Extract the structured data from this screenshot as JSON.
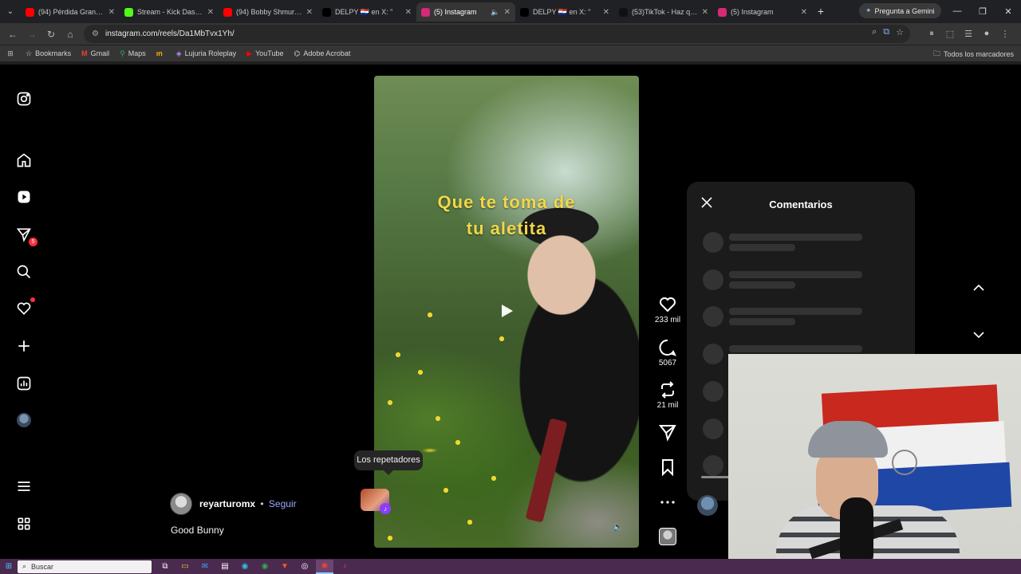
{
  "browser": {
    "tabs": [
      {
        "label": "(94) Pérdida Grande...",
        "icon": "youtube-icon",
        "color": "#ff0000",
        "active": false
      },
      {
        "label": "Stream - Kick Dashbo",
        "icon": "kick-icon",
        "color": "#53fc18",
        "active": false
      },
      {
        "label": "(94) Bobby Shmurda",
        "icon": "youtube-icon",
        "color": "#ff0000",
        "active": false
      },
      {
        "label": "DELPY 🇵🇾 en X: \"",
        "icon": "x-icon",
        "color": "#000000",
        "active": false
      },
      {
        "label": "(5) Instagram",
        "icon": "instagram-icon",
        "color": "#d62976",
        "active": true
      },
      {
        "label": "DELPY 🇵🇾 en X: \"",
        "icon": "x-icon",
        "color": "#000000",
        "active": false
      },
      {
        "label": "(53)TikTok - Haz que",
        "icon": "tiktok-icon",
        "color": "#111111",
        "active": false
      },
      {
        "label": "(5) Instagram",
        "icon": "instagram-icon",
        "color": "#d62976",
        "active": false
      }
    ],
    "gemini_button": "Pregunta a Gemini",
    "url": "instagram.com/reels/Da1MbTvx1Yh/",
    "bookmarks": [
      {
        "label": "Bookmarks",
        "icon": "star-icon"
      },
      {
        "label": "Gmail",
        "icon": "gmail-icon"
      },
      {
        "label": "Maps",
        "icon": "maps-icon"
      },
      {
        "label": "",
        "icon": "kick-small-icon"
      },
      {
        "label": "Lujuria Roleplay",
        "icon": "roleplay-icon"
      },
      {
        "label": "YouTube",
        "icon": "youtube-icon"
      },
      {
        "label": "Adobe Acrobat",
        "icon": "acrobat-icon"
      }
    ],
    "all_bookmarks": "Todos los marcadores"
  },
  "sidebar": {
    "messages_badge": "5"
  },
  "reel": {
    "caption_line1": "Que te toma de",
    "caption_line2": "tu aletita",
    "author": "reyarturomx",
    "separator": "•",
    "follow": "Seguir",
    "description": "Good Bunny",
    "audio_tooltip": "Los repetadores"
  },
  "actions": {
    "likes": "233 mil",
    "comments": "5067",
    "reposts": "21 mil"
  },
  "comments_panel": {
    "title": "Comentarios"
  },
  "taskbar": {
    "search_placeholder": "Buscar"
  }
}
